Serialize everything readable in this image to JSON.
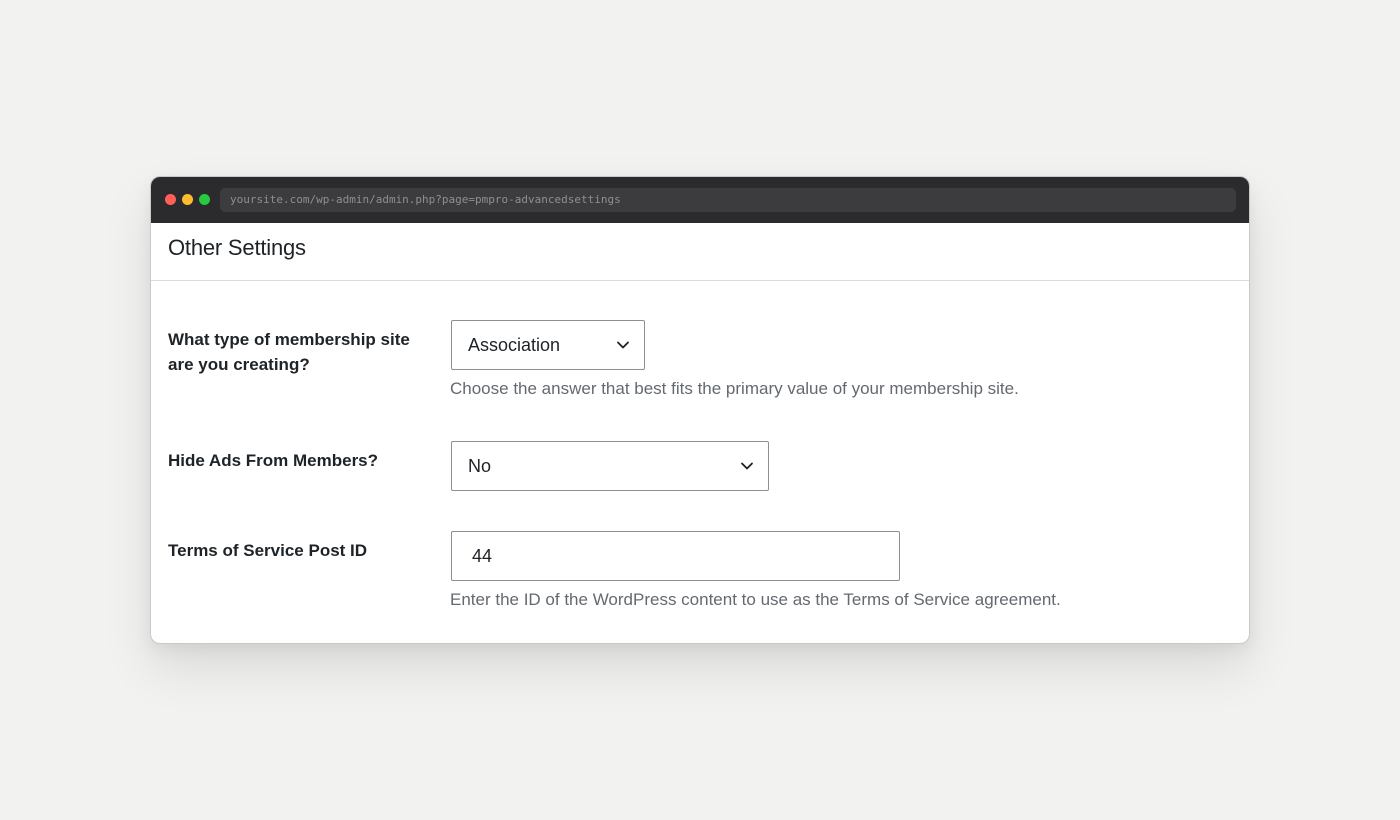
{
  "browser": {
    "url": "yoursite.com/wp-admin/admin.php?page=pmpro-advancedsettings"
  },
  "page": {
    "title": "Other Settings"
  },
  "settings": {
    "site_type": {
      "label": "What type of membership site are you creating?",
      "selected": "Association",
      "help": "Choose the answer that best fits the primary value of your membership site."
    },
    "hide_ads": {
      "label": "Hide Ads From Members?",
      "selected": "No"
    },
    "tos_post_id": {
      "label": "Terms of Service Post ID",
      "value": "44",
      "help": "Enter the ID of the WordPress content to use as the Terms of Service agreement."
    }
  },
  "icons": {
    "dropdown": "chevron-down-icon",
    "window_controls": [
      "close-dot",
      "minimize-dot",
      "maximize-dot"
    ]
  },
  "colors": {
    "titlebar": "#2b2b2d",
    "close": "#fe5f57",
    "minimize": "#febc2e",
    "maximize": "#28c840",
    "text": "#1d2327",
    "help_text": "#646970",
    "input_border": "#8c8f94"
  }
}
